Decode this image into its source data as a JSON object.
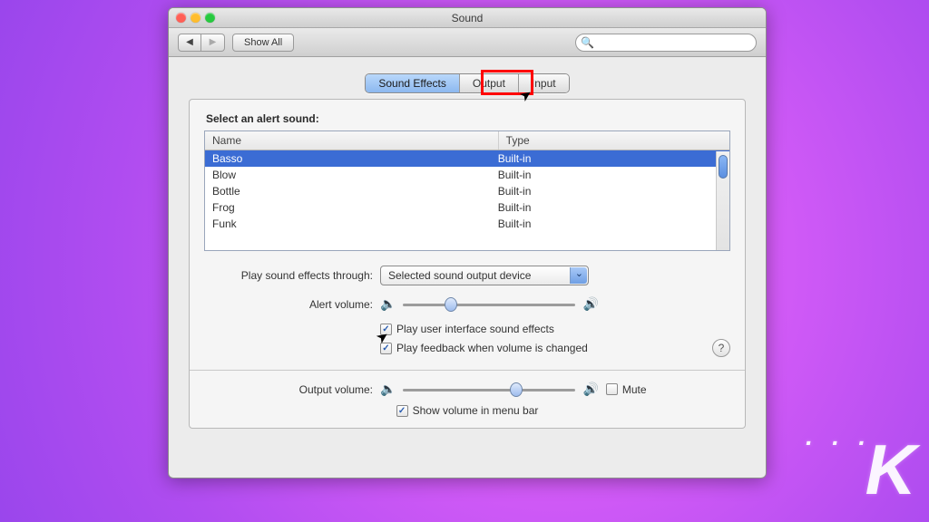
{
  "window": {
    "title": "Sound"
  },
  "toolbar": {
    "back_glyph": "◀",
    "fwd_glyph": "▶",
    "show_all": "Show All",
    "search_placeholder": ""
  },
  "tabs": {
    "items": [
      "Sound Effects",
      "Output",
      "Input"
    ],
    "active_index": 0,
    "highlighted_index": 1
  },
  "alert_section": {
    "heading": "Select an alert sound:",
    "columns": {
      "name": "Name",
      "type": "Type"
    },
    "rows": [
      {
        "name": "Basso",
        "type": "Built-in",
        "selected": true
      },
      {
        "name": "Blow",
        "type": "Built-in",
        "selected": false
      },
      {
        "name": "Bottle",
        "type": "Built-in",
        "selected": false
      },
      {
        "name": "Frog",
        "type": "Built-in",
        "selected": false
      },
      {
        "name": "Funk",
        "type": "Built-in",
        "selected": false
      }
    ]
  },
  "play_through": {
    "label": "Play sound effects through:",
    "value": "Selected sound output device"
  },
  "alert_volume": {
    "label": "Alert volume:",
    "percent": 24
  },
  "checkboxes": {
    "ui_effects": {
      "label": "Play user interface sound effects",
      "checked": true
    },
    "feedback": {
      "label": "Play feedback when volume is changed",
      "checked": true
    },
    "mute": {
      "label": "Mute",
      "checked": false
    },
    "menubar": {
      "label": "Show volume in menu bar",
      "checked": true
    }
  },
  "output_volume": {
    "label": "Output volume:",
    "percent": 62
  },
  "glyphs": {
    "speaker_low": "🔈",
    "speaker_high": "🔊",
    "check": "✓",
    "help": "?",
    "search": "🔍",
    "cursor": "➤"
  },
  "watermark": {
    "dots": "· · ·",
    "letter": "K"
  }
}
